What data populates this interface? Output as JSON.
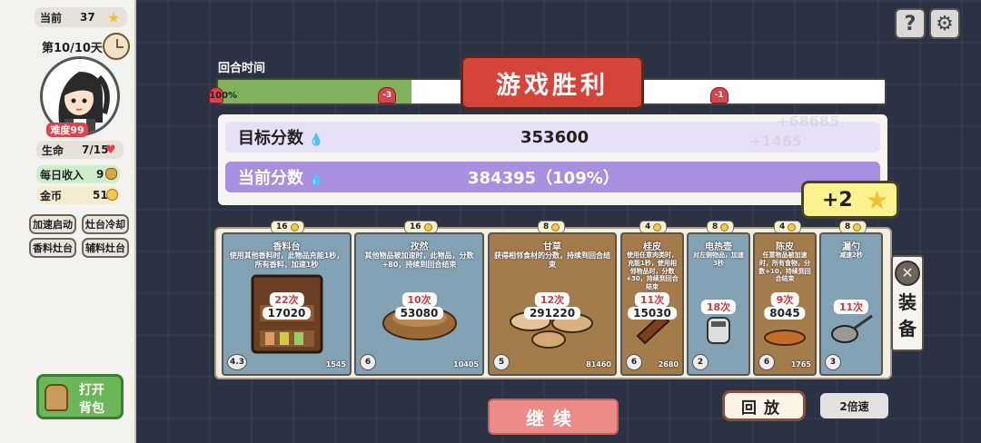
{
  "sidebar": {
    "current_label": "当前",
    "current_value": "37",
    "day_label": "第10/10天",
    "difficulty": "难度99",
    "life_label": "生命",
    "life_value": "7/15",
    "daily_income_label": "每日收入",
    "daily_income_value": "9",
    "coins_label": "金币",
    "coins_value": "51",
    "buttons": [
      "加速启动",
      "灶台冷却",
      "香料灶台",
      "辅料灶台"
    ],
    "bag_button_line1": "打开",
    "bag_button_line2": "背包"
  },
  "timeline": {
    "label": "回合时间",
    "start_label": "-100%",
    "progress_fraction": 0.29,
    "markers": [
      {
        "label": "-3",
        "position_fraction": 0.255
      },
      {
        "label": "-1",
        "position_fraction": 0.75
      }
    ]
  },
  "victory_text": "游戏胜利",
  "scores": {
    "target_label": "目标分数",
    "target_value": "353600",
    "current_label": "当前分数",
    "current_value": "384395（109%）",
    "ghost_1": "+68685",
    "ghost_2": "+1465"
  },
  "reward": {
    "value": "+2"
  },
  "cards": [
    {
      "cost": "16",
      "name": "香料台",
      "desc": "使用其他香料时，此物品充能1秒，所有香料，加速1秒",
      "times": "22次",
      "score": "17020",
      "level": "4.3",
      "corner": "1545",
      "style": "blue"
    },
    {
      "cost": "16",
      "name": "孜然",
      "desc": "其他物品被加速时，此物品，分数+80，持续到回合结束",
      "times": "10次",
      "score": "53080",
      "level": "6",
      "corner": "10405",
      "style": "blue"
    },
    {
      "cost": "8",
      "name": "甘草",
      "desc": "获得相邻食材的分数，持续到回合结束",
      "times": "12次",
      "score": "291220",
      "level": "5",
      "corner": "81460",
      "style": "brown"
    },
    {
      "cost": "4",
      "name": "桂皮",
      "desc": "使用任意肉类时，充能1秒，使用相邻物品时，分数+30，持续到回合结束",
      "times": "11次",
      "score": "15030",
      "level": "6",
      "corner": "2680",
      "style": "brown"
    },
    {
      "cost": "8",
      "name": "电热壶",
      "desc": "对左侧物品，加速3秒",
      "times": "18次",
      "score": "",
      "level": "2",
      "corner": "",
      "style": "blue"
    },
    {
      "cost": "4",
      "name": "陈皮",
      "desc": "任意物品被加速时，所有食物，分数+10，持续到回合结束",
      "times": "9次",
      "score": "8045",
      "level": "6",
      "corner": "1765",
      "style": "brown"
    },
    {
      "cost": "8",
      "name": "漏勺",
      "desc": "减速2秒",
      "times": "11次",
      "score": "",
      "level": "3",
      "corner": "",
      "style": "blue"
    }
  ],
  "equip_tab": {
    "line1": "装",
    "line2": "备"
  },
  "bottom": {
    "continue_label": "继续",
    "replay_label": "回放",
    "speed_label": "2倍速"
  },
  "colors": {
    "victory_red": "#d64339",
    "timeline_green": "#7fb25a",
    "target_row": "#e8e0f7",
    "current_row": "#a98fe0",
    "reward_yellow": "#f9f28e"
  },
  "icons": [
    "star-icon",
    "clock-icon",
    "heart-icon",
    "money-bag-icon",
    "coin-icon",
    "question-icon",
    "gear-icon",
    "water-drop-icon",
    "backpack-icon",
    "crossed-tools-icon"
  ]
}
